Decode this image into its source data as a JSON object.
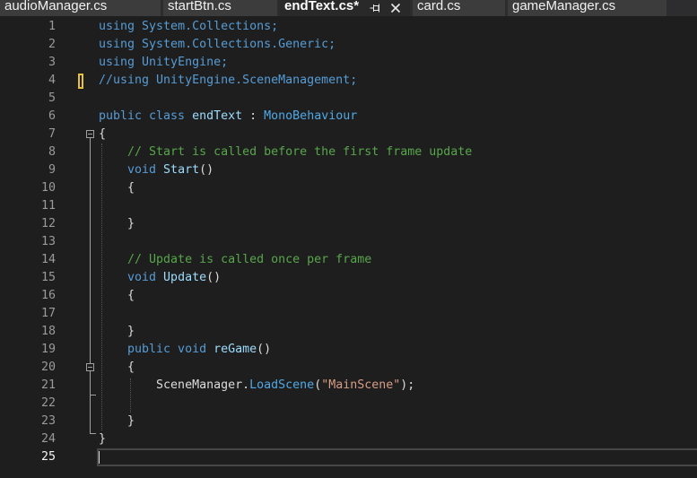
{
  "tabs": [
    {
      "label": "audioManager.cs",
      "active": false
    },
    {
      "label": "startBtn.cs",
      "active": false
    },
    {
      "label": "endText.cs*",
      "active": true
    },
    {
      "label": "card.cs",
      "active": false
    },
    {
      "label": "gameManager.cs",
      "active": false
    }
  ],
  "active_tab_icons": [
    "pin-icon",
    "close-icon"
  ],
  "ui_colors": {
    "editor_bg": "#1e1e1e",
    "tab_strip_bg": "#2d2d30",
    "tab_bg": "#3c3c3c",
    "tab_active_bg": "#292929",
    "tab_text": "#f1f1f1",
    "tab_active_text": "#ffffff",
    "icon": "#e8e8e8",
    "line_number": "#9a9a9a",
    "current_line_number": "#f5f5f5",
    "current_line_border": "#464646",
    "caret": "#dcdcdc",
    "change_marker": "#e6c23a",
    "fold_marker": "#a0a0a0",
    "indent_guide": "#555555"
  },
  "editor": {
    "lines": [
      {
        "n": 1,
        "tokens": [
          {
            "t": "using",
            "color": "#569cd6"
          },
          {
            "t": " System.Collections;",
            "color": "#569cd6"
          }
        ]
      },
      {
        "n": 2,
        "tokens": [
          {
            "t": "using",
            "color": "#569cd6"
          },
          {
            "t": " System.Collections.Generic;",
            "color": "#569cd6"
          }
        ]
      },
      {
        "n": 3,
        "tokens": [
          {
            "t": "using",
            "color": "#569cd6"
          },
          {
            "t": " UnityEngine;",
            "color": "#569cd6"
          }
        ]
      },
      {
        "n": 4,
        "changed": true,
        "tokens": [
          {
            "t": "//using UnityEngine.SceneManagement;",
            "color": "#569cd6"
          }
        ]
      },
      {
        "n": 5,
        "tokens": []
      },
      {
        "n": 6,
        "tokens": [
          {
            "t": "public class",
            "color": "#569cd6"
          },
          {
            "t": " endText",
            "color": "#9cdcfe"
          },
          {
            "t": " : ",
            "color": "#dcdcdc"
          },
          {
            "t": "MonoBehaviour",
            "color": "#4fa9e6"
          }
        ]
      },
      {
        "n": 7,
        "fold": true,
        "tokens": [
          {
            "t": "{",
            "color": "#dcdcdc"
          }
        ]
      },
      {
        "n": 8,
        "tokens": [
          {
            "t": "    // Start is called before the first frame update",
            "color": "#57a64a"
          }
        ]
      },
      {
        "n": 9,
        "tokens": [
          {
            "t": "    void",
            "color": "#569cd6"
          },
          {
            "t": " Start",
            "color": "#9cdcfe"
          },
          {
            "t": "()",
            "color": "#dcdcdc"
          }
        ]
      },
      {
        "n": 10,
        "tokens": [
          {
            "t": "    {",
            "color": "#dcdcdc"
          }
        ]
      },
      {
        "n": 11,
        "tokens": []
      },
      {
        "n": 12,
        "tokens": [
          {
            "t": "    }",
            "color": "#dcdcdc"
          }
        ]
      },
      {
        "n": 13,
        "tokens": []
      },
      {
        "n": 14,
        "tokens": [
          {
            "t": "    // Update is called once per frame",
            "color": "#57a64a"
          }
        ]
      },
      {
        "n": 15,
        "tokens": [
          {
            "t": "    void",
            "color": "#569cd6"
          },
          {
            "t": " Update",
            "color": "#9cdcfe"
          },
          {
            "t": "()",
            "color": "#dcdcdc"
          }
        ]
      },
      {
        "n": 16,
        "tokens": [
          {
            "t": "    {",
            "color": "#dcdcdc"
          }
        ]
      },
      {
        "n": 17,
        "tokens": []
      },
      {
        "n": 18,
        "tokens": [
          {
            "t": "    }",
            "color": "#dcdcdc"
          }
        ]
      },
      {
        "n": 19,
        "tokens": [
          {
            "t": "    public void",
            "color": "#569cd6"
          },
          {
            "t": " reGame",
            "color": "#9cdcfe"
          },
          {
            "t": "()",
            "color": "#dcdcdc"
          }
        ]
      },
      {
        "n": 20,
        "fold": true,
        "tokens": [
          {
            "t": "    {",
            "color": "#dcdcdc"
          }
        ]
      },
      {
        "n": 21,
        "tokens": [
          {
            "t": "        SceneManager",
            "color": "#dcdcdc"
          },
          {
            "t": ".",
            "color": "#dcdcdc"
          },
          {
            "t": "LoadScene",
            "color": "#4fa9e6"
          },
          {
            "t": "(",
            "color": "#dcdcdc"
          },
          {
            "t": "\"MainScene\"",
            "color": "#d69d85"
          },
          {
            "t": ");",
            "color": "#dcdcdc"
          }
        ]
      },
      {
        "n": 22,
        "tokens": []
      },
      {
        "n": 23,
        "tokens": [
          {
            "t": "    }",
            "color": "#dcdcdc"
          }
        ]
      },
      {
        "n": 24,
        "tokens": [
          {
            "t": "}",
            "color": "#dcdcdc"
          }
        ]
      },
      {
        "n": 25,
        "current": true,
        "tokens": []
      }
    ]
  }
}
